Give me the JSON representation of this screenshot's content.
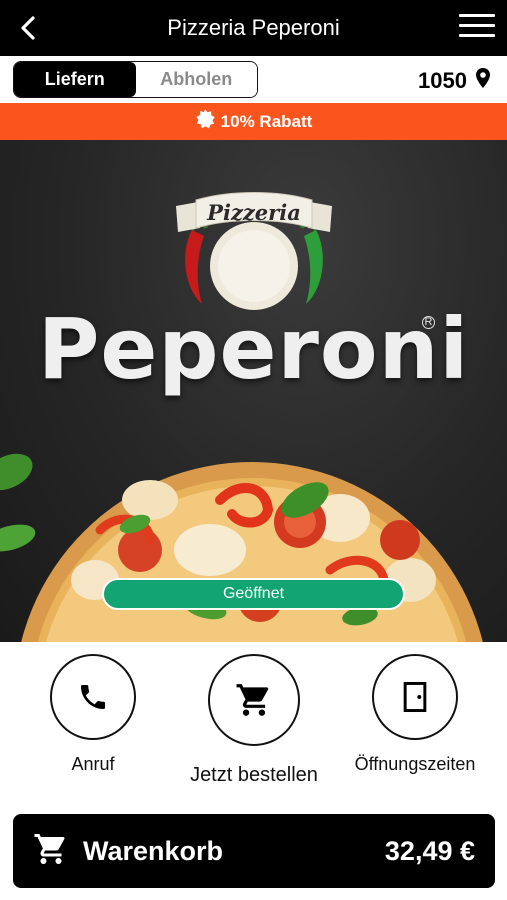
{
  "header": {
    "title": "Pizzeria Peperoni",
    "back_icon": "chevron-left-icon",
    "menu_icon": "hamburger-menu-icon"
  },
  "mode": {
    "options": [
      "Liefern",
      "Abholen"
    ],
    "selected": "Liefern",
    "postal_code": "1050",
    "location_icon": "map-pin-icon"
  },
  "promo": {
    "icon": "badge-icon",
    "text": "10% Rabatt",
    "color": "#fb551e"
  },
  "hero": {
    "logo_banner": "Pizzeria",
    "brand": "Peperoni",
    "registered_mark": "R",
    "status": "Geöffnet",
    "status_color": "#12a472"
  },
  "actions": [
    {
      "label": "Anruf",
      "icon": "phone-icon"
    },
    {
      "label": "Jetzt bestellen",
      "icon": "shopping-cart-icon"
    },
    {
      "label": "Öffnungszeiten",
      "icon": "door-icon"
    }
  ],
  "cart": {
    "icon": "shopping-cart-icon",
    "label": "Warenkorb",
    "total": "32,49 €"
  }
}
